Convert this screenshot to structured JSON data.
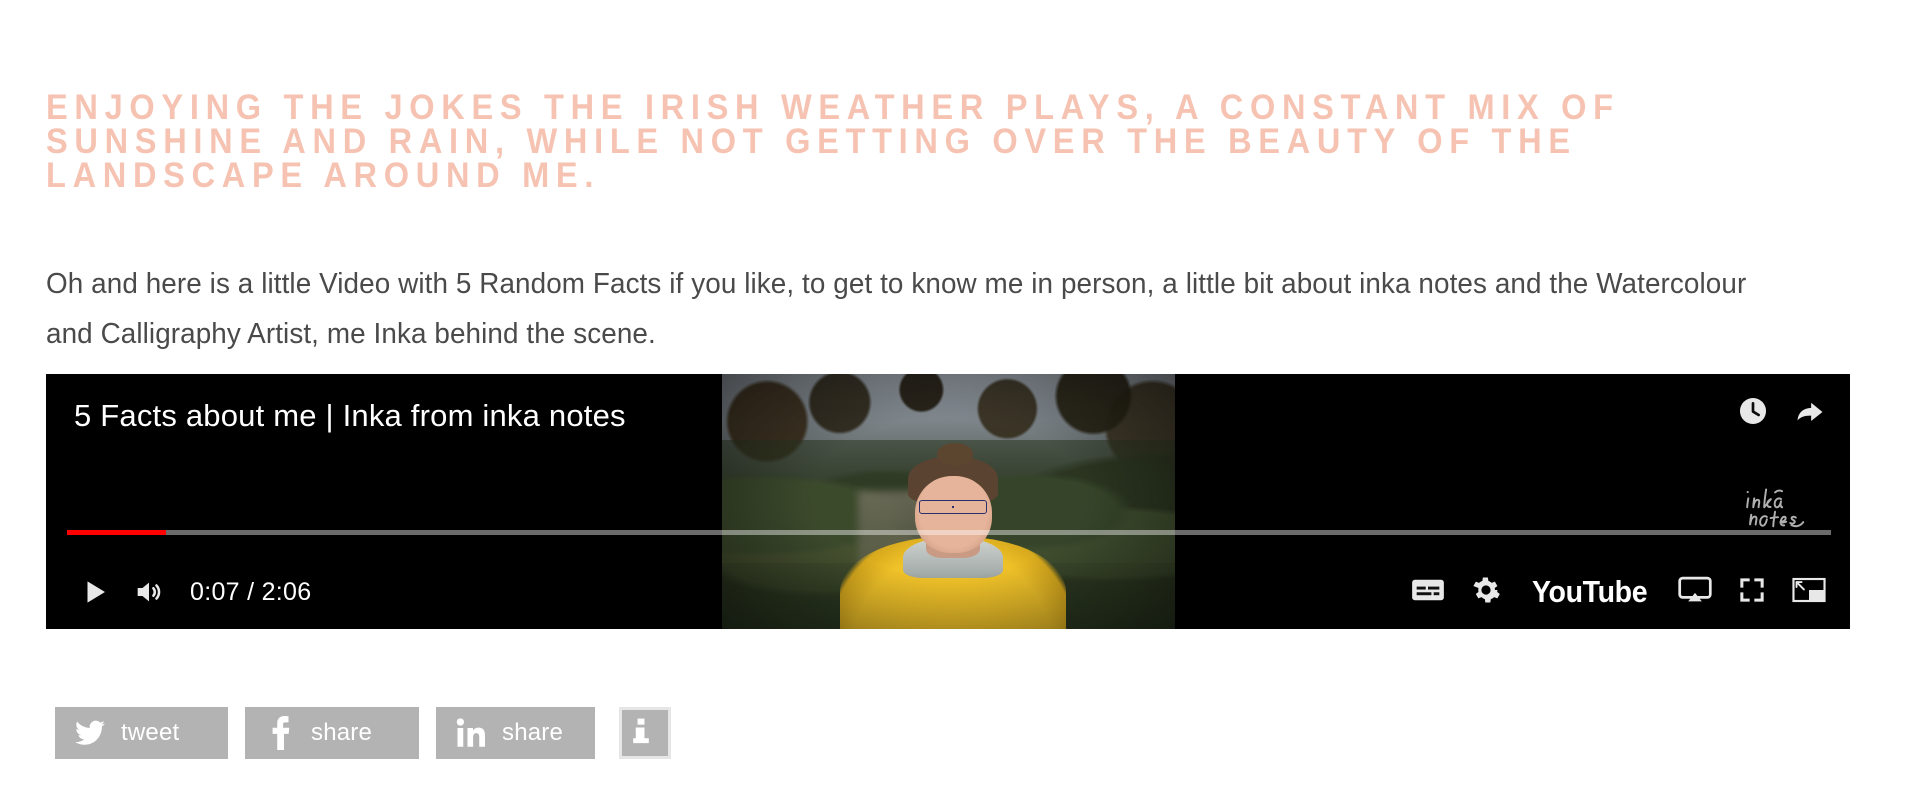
{
  "post": {
    "heading": "Enjoying the jokes the Irish weather plays, a constant mix of sunshine and rain, while not getting over the beauty of the landscape around me.",
    "heading_color": "#f6c3b2",
    "body": "Oh and here is a little Video with 5 Random Facts if you like, to get to know me in person, a little bit about inka notes and the Watercolour and Calligraphy Artist, me Inka behind the scene.",
    "body_color": "#4a4a4a"
  },
  "player": {
    "video_title": "5 Facts about me | Inka from inka notes",
    "current_time": "0:07",
    "duration": "2:06",
    "time_display": "0:07 / 2:06",
    "progress_percent": 5.6,
    "progress_color": "#ff0000",
    "brand_wordmark": "YouTube",
    "watermark_line1": "inka",
    "watermark_line2": "notes",
    "controls": {
      "play": "Play",
      "mute": "Mute",
      "watch_later": "Watch later",
      "share": "Share",
      "subtitles": "Subtitles/closed captions",
      "settings": "Settings",
      "watch_on_youtube": "Watch on YouTube",
      "cast": "Play on TV",
      "fullscreen": "Full screen",
      "miniplayer": "Miniplayer"
    }
  },
  "share_bar": {
    "background": "#b3b3b3",
    "buttons": [
      {
        "network": "twitter",
        "label": "tweet"
      },
      {
        "network": "facebook",
        "label": "share"
      },
      {
        "network": "linkedin",
        "label": "share"
      }
    ],
    "info_label": "i"
  }
}
